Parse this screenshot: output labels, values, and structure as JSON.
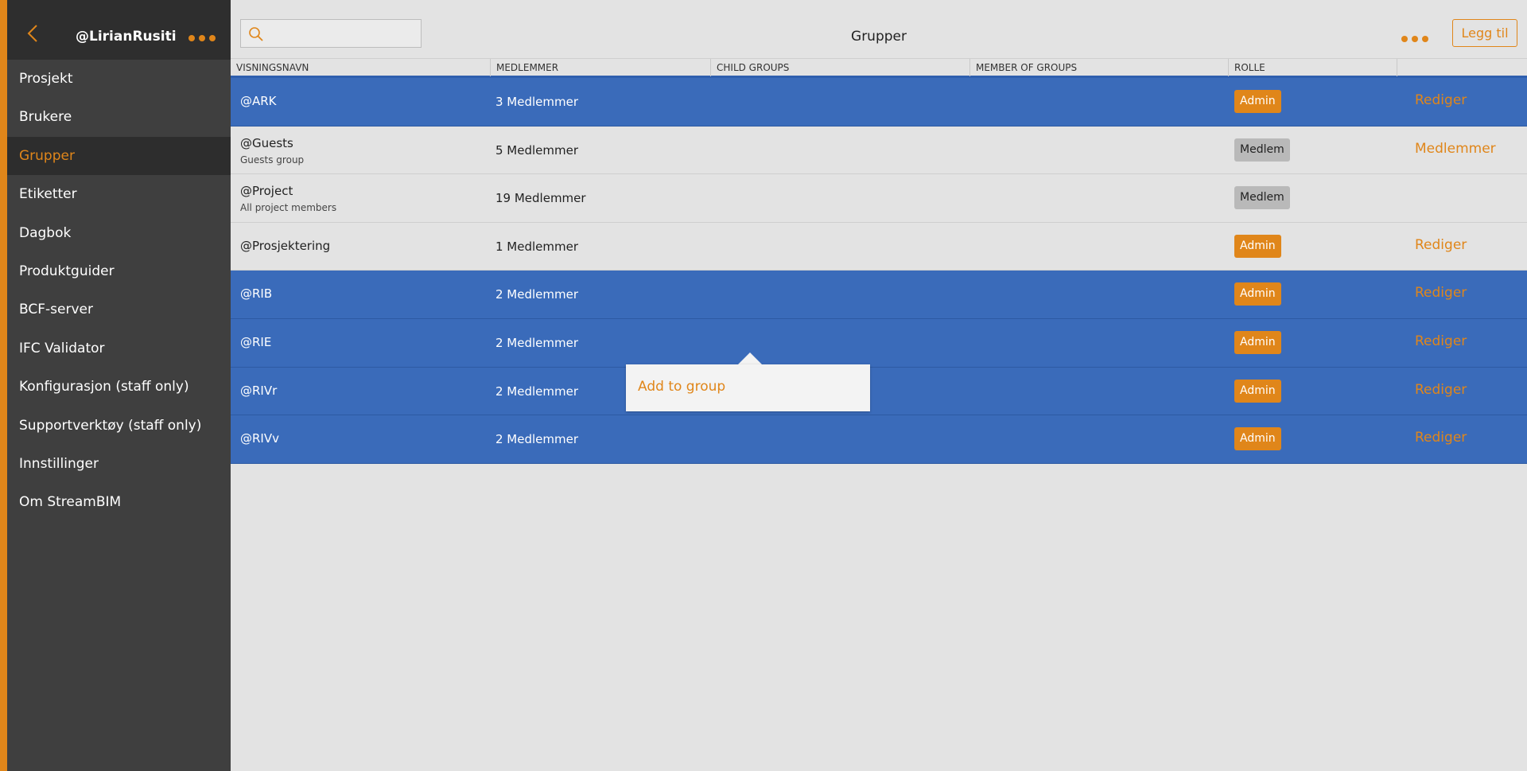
{
  "sidebar": {
    "username": "@LirianRusiti",
    "items": [
      {
        "label": "Prosjekt",
        "active": false
      },
      {
        "label": "Brukere",
        "active": false
      },
      {
        "label": "Grupper",
        "active": true
      },
      {
        "label": "Etiketter",
        "active": false
      },
      {
        "label": "Dagbok",
        "active": false
      },
      {
        "label": "Produktguider",
        "active": false
      },
      {
        "label": "BCF-server",
        "active": false
      },
      {
        "label": "IFC Validator",
        "active": false
      },
      {
        "label": "Konfigurasjon (staff only)",
        "active": false
      },
      {
        "label": "Supportverktøy (staff only)",
        "active": false
      },
      {
        "label": "Innstillinger",
        "active": false
      },
      {
        "label": "Om StreamBIM",
        "active": false
      }
    ]
  },
  "header": {
    "title": "Grupper",
    "search_placeholder": "",
    "add_label": "Legg til"
  },
  "table": {
    "columns": [
      "VISNINGSNAVN",
      "MEDLEMMER",
      "CHILD GROUPS",
      "MEMBER OF GROUPS",
      "ROLLE",
      ""
    ],
    "rows": [
      {
        "name": "@ARK",
        "description": "",
        "members": "3 Medlemmer",
        "role": "Admin",
        "action": "Rediger",
        "selected": true
      },
      {
        "name": "@Guests",
        "description": "Guests group",
        "members": "5 Medlemmer",
        "role": "Medlem",
        "action": "Medlemmer",
        "selected": false
      },
      {
        "name": "@Project",
        "description": "All project members",
        "members": "19 Medlemmer",
        "role": "Medlem",
        "action": "",
        "selected": false
      },
      {
        "name": "@Prosjektering",
        "description": "",
        "members": "1 Medlemmer",
        "role": "Admin",
        "action": "Rediger",
        "selected": false
      },
      {
        "name": "@RIB",
        "description": "",
        "members": "2 Medlemmer",
        "role": "Admin",
        "action": "Rediger",
        "selected": true
      },
      {
        "name": "@RIE",
        "description": "",
        "members": "2 Medlemmer",
        "role": "Admin",
        "action": "Rediger",
        "selected": true
      },
      {
        "name": "@RIVr",
        "description": "",
        "members": "2 Medlemmer",
        "role": "Admin",
        "action": "Rediger",
        "selected": true
      },
      {
        "name": "@RIVv",
        "description": "",
        "members": "2 Medlemmer",
        "role": "Admin",
        "action": "Rediger",
        "selected": true
      }
    ]
  },
  "popup": {
    "item_label": "Add to group"
  },
  "colors": {
    "accent": "#e0861a",
    "selected_row": "#3a6bba",
    "sidebar_bg": "#3f3f3f"
  },
  "icons": [
    "chevron-left-icon",
    "more-dots-icon",
    "search-icon"
  ]
}
